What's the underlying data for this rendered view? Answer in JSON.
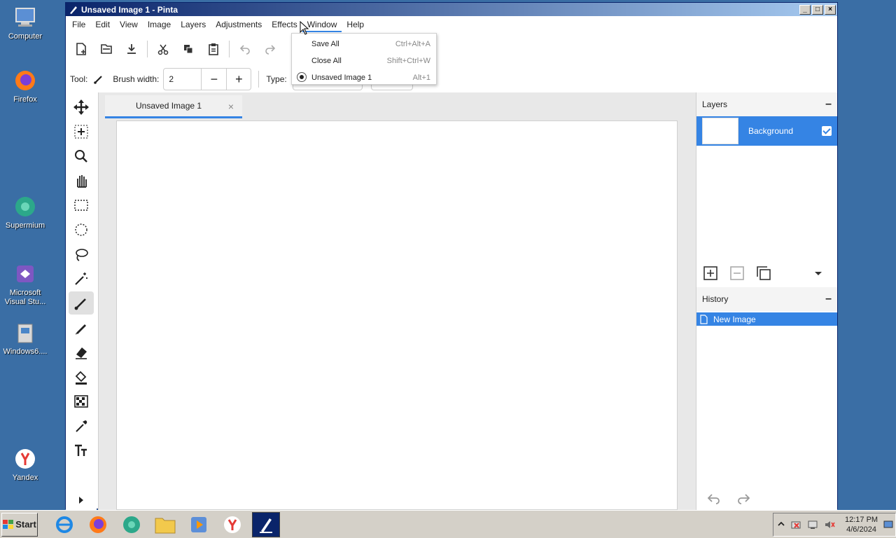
{
  "desktop": {
    "icons": [
      {
        "label": "Computer"
      },
      {
        "label": "Firefox"
      },
      {
        "label": "Supermium"
      },
      {
        "label": "Microsoft Visual Stu..."
      },
      {
        "label": "Windows6...."
      },
      {
        "label": "Yandex"
      }
    ]
  },
  "window": {
    "title": "Unsaved Image 1 - Pinta",
    "controls": {
      "minimize": "_",
      "maximize": "□",
      "close": "×"
    }
  },
  "menubar": {
    "items": [
      "File",
      "Edit",
      "View",
      "Image",
      "Layers",
      "Adjustments",
      "Effects",
      "Window",
      "Help"
    ]
  },
  "toolbar2": {
    "tool_label": "Tool:",
    "brush_width_label": "Brush width:",
    "brush_width_value": "2",
    "minus": "−",
    "plus": "+",
    "type_label": "Type:"
  },
  "window_menu": {
    "items": [
      {
        "label": "Save All",
        "shortcut": "Ctrl+Alt+A"
      },
      {
        "label": "Close All",
        "shortcut": "Shift+Ctrl+W"
      },
      {
        "label": "Unsaved Image 1",
        "shortcut": "Alt+1"
      }
    ]
  },
  "document": {
    "tab_label": "Unsaved Image 1",
    "close_glyph": "×"
  },
  "layers_panel": {
    "title": "Layers",
    "collapse": "–",
    "layers": [
      {
        "name": "Background",
        "visible": true
      }
    ]
  },
  "history_panel": {
    "title": "History",
    "collapse": "–",
    "items": [
      {
        "label": "New Image"
      }
    ]
  },
  "taskbar": {
    "start_label": "Start",
    "clock_time": "12:17 PM",
    "clock_date": "4/6/2024"
  },
  "colors": {
    "accent": "#3584e4",
    "desktop": "#3a6ea5",
    "titlebar": "#0a246a"
  }
}
